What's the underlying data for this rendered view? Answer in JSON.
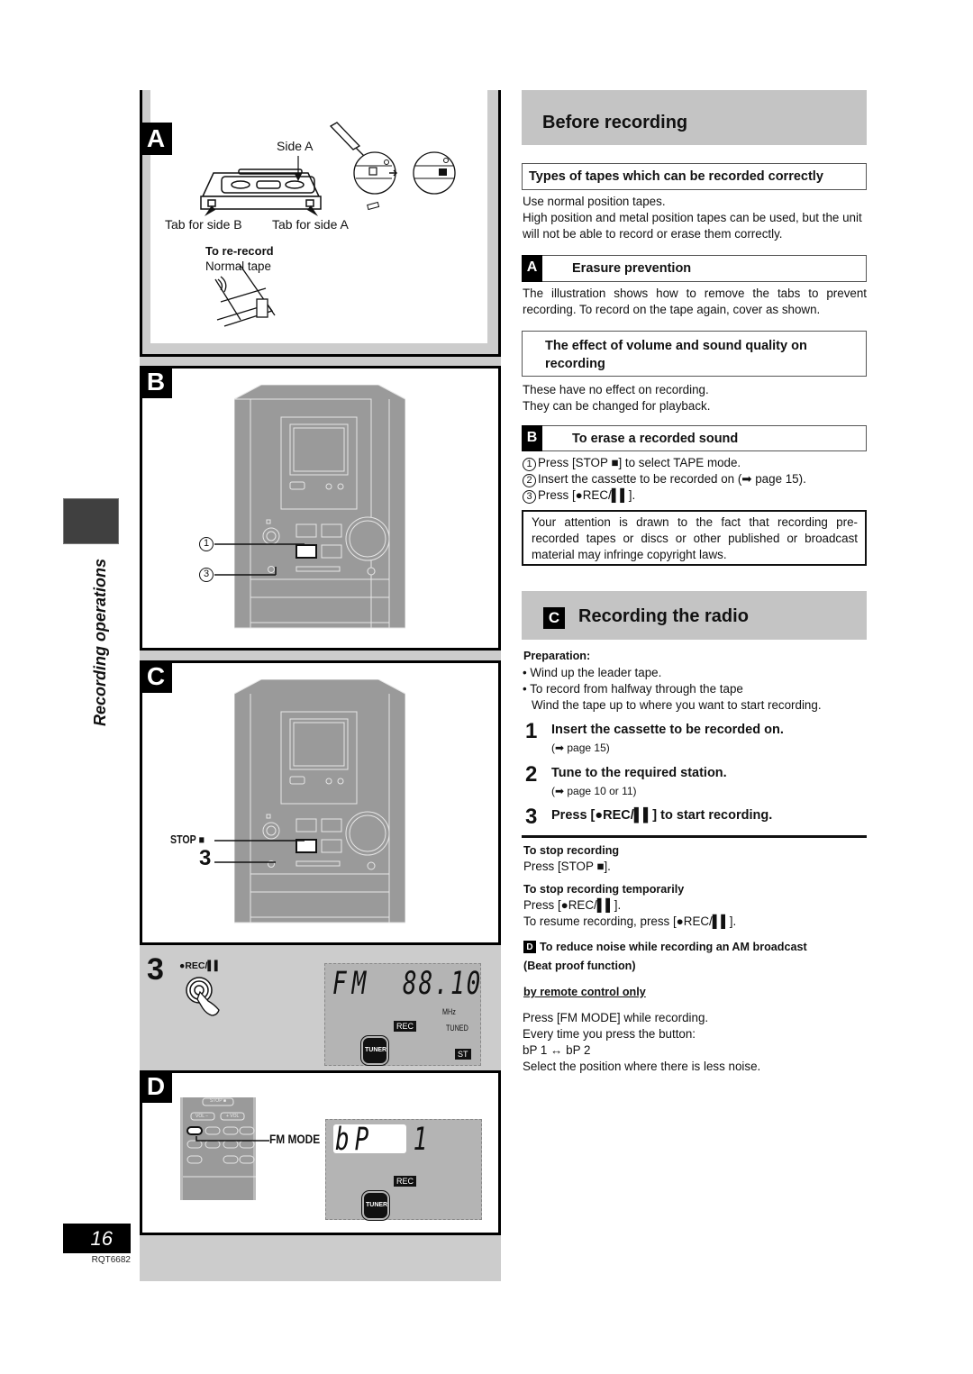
{
  "side_tab": {
    "label": "Recording operations"
  },
  "footer": {
    "page_number": "16",
    "doc_code": "RQT6682"
  },
  "figures": {
    "panel_a": {
      "letter": "A",
      "side_a_label": "Side A",
      "tab_side_b": "Tab for side B",
      "tab_side_a": "Tab for side A",
      "re_record_title": "To re-record",
      "re_record_sub": "Normal tape"
    },
    "panel_b": {
      "letter": "B",
      "callouts": [
        "1",
        "3"
      ]
    },
    "panel_c": {
      "letter": "C",
      "stop_label": "STOP ■",
      "callout": "3"
    },
    "panel_rec": {
      "step": "3",
      "button_label": "●REC/▌▌",
      "display": {
        "band": "FM",
        "frequency": "88.10",
        "unit": "MHz",
        "rec": "REC",
        "tuned": "TUNED",
        "tuner": "TUNER",
        "stereo": "ST"
      }
    },
    "panel_d": {
      "letter": "D",
      "fm_mode_label": "FM MODE",
      "remote_buttons": {
        "stop": "STOP ■",
        "vol_down": "VOL −",
        "vol_up": "+ VOL"
      },
      "display": {
        "text": "bP  1",
        "rec": "REC",
        "tuner": "TUNER"
      }
    }
  },
  "before_recording": {
    "title": "Before recording",
    "types": {
      "heading": "Types of tapes which can be recorded correctly",
      "lines": [
        "Use normal position tapes.",
        "High position and metal position tapes can be used, but the unit will not be able to record or erase them correctly."
      ]
    },
    "erasure": {
      "letter": "A",
      "heading": "Erasure prevention",
      "text": "The illustration shows how to remove the tabs to prevent recording. To record on the tape again, cover as shown."
    },
    "effect": {
      "heading": "The effect of volume and sound quality on recording",
      "lines": [
        "These have no effect on recording.",
        "They can be changed for playback."
      ]
    },
    "erase": {
      "letter": "B",
      "heading": "To erase a recorded sound",
      "steps": [
        {
          "num": "1",
          "text": "Press [STOP ■] to select TAPE mode."
        },
        {
          "num": "2",
          "text": "Insert the cassette to be recorded on (➡ page 15)."
        },
        {
          "num": "3",
          "text": "Press [●REC/▌▌]."
        }
      ]
    },
    "notice": "Your attention is drawn to the fact that recording pre-recorded tapes or discs or other published or broadcast material may infringe copyright laws."
  },
  "recording_radio": {
    "letter": "C",
    "title": "Recording the radio",
    "preparation_heading": "Preparation:",
    "preparation": [
      "• Wind up the leader tape.",
      "• To record from halfway through the tape",
      "Wind the tape up to where you want to start recording."
    ],
    "steps": [
      {
        "num": "1",
        "text": "Insert the cassette to be recorded on.",
        "sub": "(➡ page 15)"
      },
      {
        "num": "2",
        "text": "Tune to the required station.",
        "sub": "(➡ page 10 or 11)"
      },
      {
        "num": "3",
        "text": "Press [●REC/▌▌] to start recording.",
        "sub": ""
      }
    ],
    "stop": {
      "heading": "To stop recording",
      "text": "Press [STOP ■]."
    },
    "pause": {
      "heading": "To stop recording temporarily",
      "text": "Press [●REC/▌▌].",
      "resume": "To resume recording, press [●REC/▌▌]."
    },
    "beat_proof": {
      "letter": "D",
      "heading": "To reduce noise while recording an AM broadcast",
      "heading2": "(Beat proof function)",
      "remote_only": "by remote control only",
      "lines": [
        "Press [FM MODE] while recording.",
        "Every time you press the button:",
        "bP 1 ↔ bP 2",
        "Select the position where there is less noise."
      ]
    }
  }
}
